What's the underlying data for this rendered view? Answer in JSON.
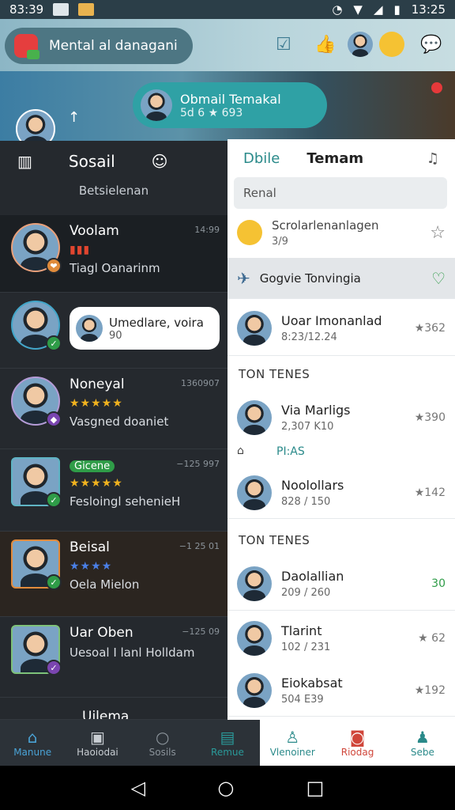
{
  "status": {
    "time_left": "83:39",
    "time_right": "13:25"
  },
  "topbar": {
    "title": "Mental al danagani"
  },
  "banner": {
    "pill_title": "Obmail Temakal",
    "pill_sub": "5d 6 ★ 693"
  },
  "left": {
    "tabs": [
      "Sosail"
    ],
    "subtitle": "Betsielenan",
    "rows": [
      {
        "name": "Voolam",
        "line2": "▮▮▮",
        "line3": "Tiagl Oanarinm",
        "time": "14:99"
      },
      {
        "name": "Noneyal",
        "line2": "★★★★★",
        "line3": "Vasgned doaniet",
        "time": "1360907"
      },
      {
        "name": "Gicene",
        "line2": "★★★★★",
        "line3": "Fesloingl sehenieH",
        "time": "−125 997"
      },
      {
        "name": "Beisal",
        "line2": "★★★★",
        "line3": "Oela Mielon",
        "time": "−1 25 01"
      },
      {
        "name": "Uar Oben",
        "line2": "",
        "line3": "Uesoal I lanl Holldam",
        "time": "−125 09"
      },
      {
        "name": "Uilema",
        "line2": "",
        "line3": "",
        "time": ""
      }
    ],
    "bubble": {
      "title": "Umedlare, voira",
      "sub": "90"
    }
  },
  "right": {
    "tabs": {
      "a": "Dbile",
      "b": "Temam"
    },
    "search_placeholder": "Renal",
    "top_item": {
      "name": "Scrolarlenanlagen",
      "sub": "3/9"
    },
    "google_item": "Gogvie Tonvingia",
    "item1": {
      "name": "Uoar Imonanlad",
      "sub": "8:23/12.24",
      "score": "★362"
    },
    "section1": "TON TENES",
    "item2": {
      "name": "Via Marligs",
      "sub": "2,307 K10",
      "score": "★390"
    },
    "pins_label": "PI:AS",
    "item3": {
      "name": "Noolollars",
      "sub": "828 / 150",
      "score": "★142"
    },
    "section2": "TON TENES",
    "item4": {
      "name": "Daolallian",
      "sub": "209 / 260",
      "score": "30"
    },
    "item5": {
      "name": "Tlarint",
      "sub": "102 / 231",
      "score": "★ 62"
    },
    "item6": {
      "name": "Eiokabsat",
      "sub": "504 E39",
      "score": "★192"
    }
  },
  "nav": [
    "Manune",
    "Haoiodai",
    "Sosils",
    "Remue",
    "Vlenoiner",
    "Riodag",
    "Sebe"
  ]
}
